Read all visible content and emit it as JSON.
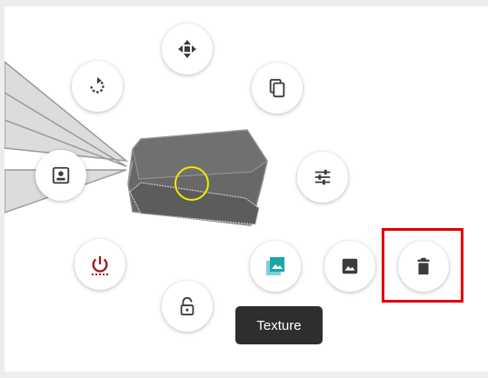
{
  "tooltip": {
    "text": "Texture"
  },
  "context_menu": {
    "buttons": [
      {
        "name": "move-button",
        "icon": "move-icon"
      },
      {
        "name": "rotate-button",
        "icon": "rotate-icon"
      },
      {
        "name": "duplicate-button",
        "icon": "copy-icon"
      },
      {
        "name": "camera-view-button",
        "icon": "portrait-icon"
      },
      {
        "name": "adjust-settings-button",
        "icon": "sliders-icon"
      },
      {
        "name": "power-button",
        "icon": "power-icon"
      },
      {
        "name": "texture-button",
        "icon": "texture-icon"
      },
      {
        "name": "image-button",
        "icon": "image-icon"
      },
      {
        "name": "delete-button",
        "icon": "trash-icon"
      },
      {
        "name": "lock-button",
        "icon": "lock-open-icon"
      }
    ]
  },
  "colors": {
    "background": "#ededed",
    "canvas": "#ffffff",
    "object": "#6a6a6a",
    "selection_ring": "#f3e600",
    "power_red": "#9b1c1c",
    "texture_teal": "#1aa6a8",
    "highlight_red": "#e00000",
    "tooltip_bg": "#2e2e2e"
  }
}
